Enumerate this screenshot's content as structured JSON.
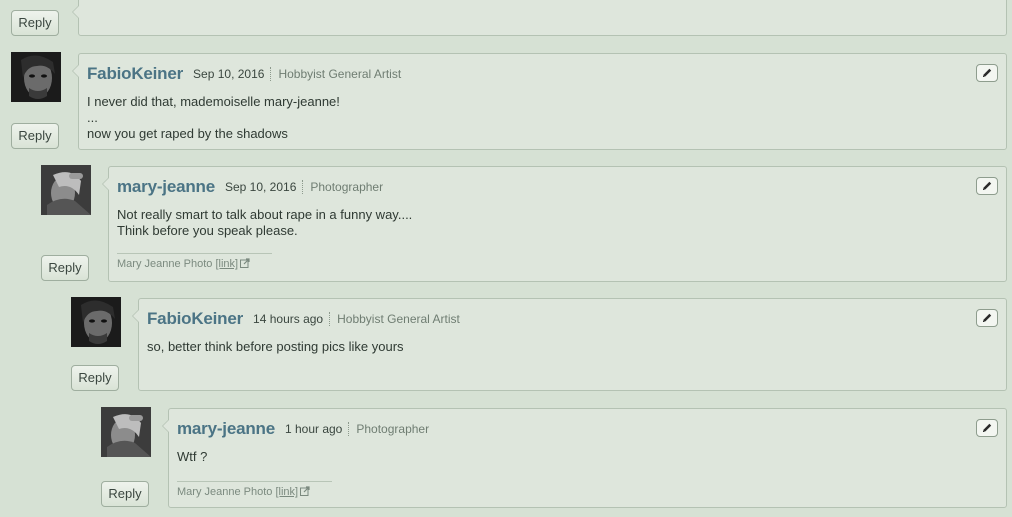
{
  "reply_label": "Reply",
  "comments": [
    {
      "user": "FabioKeiner",
      "date": "Sep 10, 2016",
      "dev_type": "Hobbyist General Artist",
      "lines": [
        "I never did that, mademoiselle mary-jeanne!",
        "...",
        "now you get raped by the shadows"
      ]
    },
    {
      "user": "mary-jeanne",
      "date": "Sep 10, 2016",
      "dev_type": "Photographer",
      "lines": [
        "Not really smart to talk about rape in a funny way....",
        "Think before you speak please."
      ],
      "signature": {
        "text": "Mary Jeanne Photo",
        "link": "[link]"
      }
    },
    {
      "user": "FabioKeiner",
      "date": "14 hours ago",
      "dev_type": "Hobbyist General Artist",
      "lines": [
        "so, better think before posting pics like yours"
      ]
    },
    {
      "user": "mary-jeanne",
      "date": "1 hour ago",
      "dev_type": "Photographer",
      "lines": [
        "Wtf ?"
      ],
      "signature": {
        "text": "Mary Jeanne Photo",
        "link": "[link]"
      }
    }
  ],
  "icons": {
    "edit": "pencil-icon",
    "external": "external-link-icon"
  },
  "colors": {
    "background": "#d6e1d4",
    "username": "#4b7485",
    "box": "#dee6dc"
  }
}
